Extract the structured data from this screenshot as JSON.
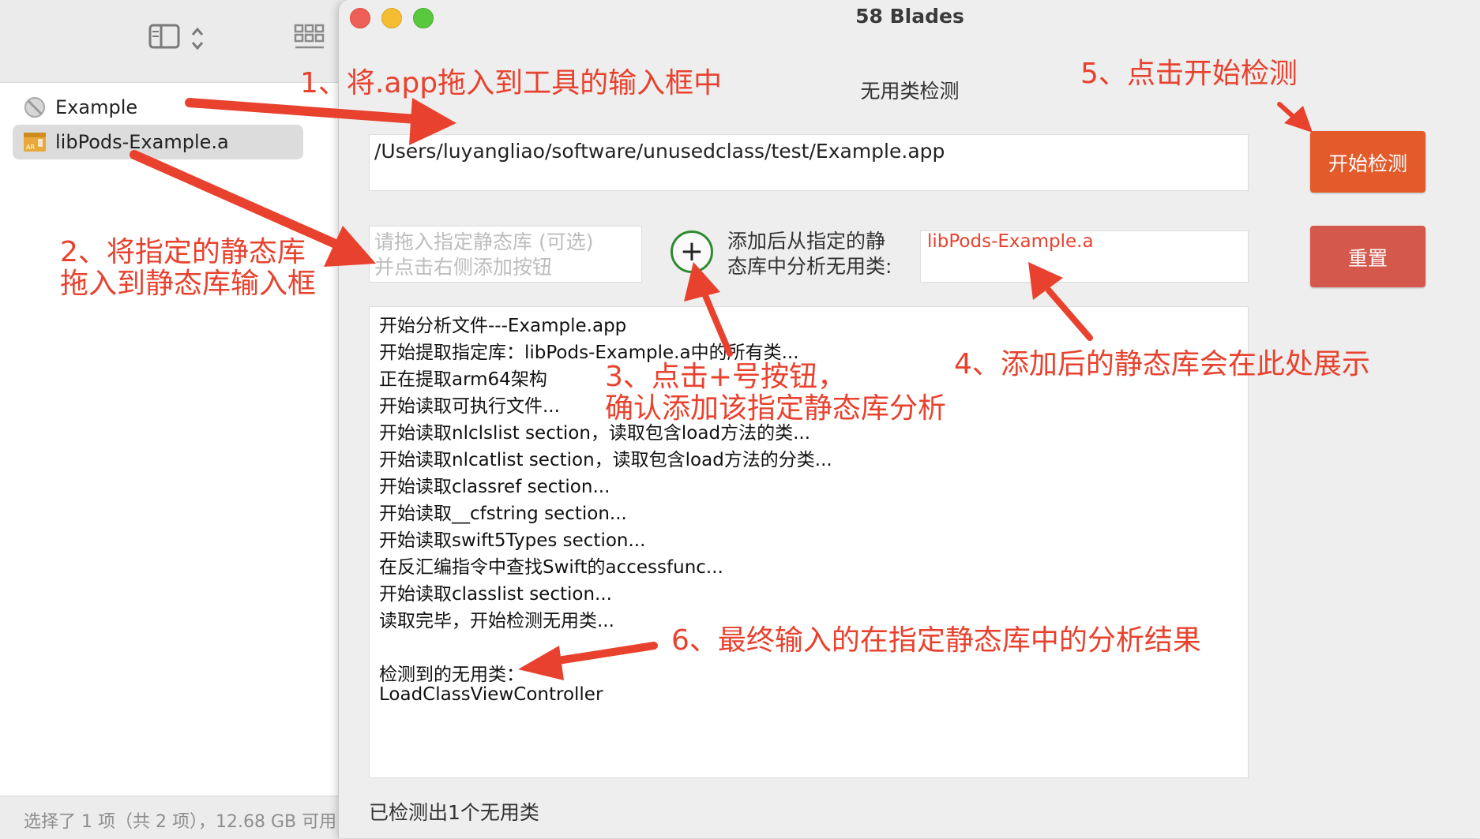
{
  "finder": {
    "sidebar_items": [
      {
        "label": "Example"
      },
      {
        "label": "libPods-Example.a"
      }
    ],
    "status": "选择了 1 项（共 2 项），12.68 GB 可用"
  },
  "window": {
    "title": "58 Blades",
    "heading": "无用类检测"
  },
  "inputs": {
    "app_path": "/Users/luyangliao/software/unusedclass/test/Example.app",
    "static_lib_placeholder": "请拖入指定静态库 (可选)\n并点击右侧添加按钮",
    "add_description": "添加后从指定的静\n态库中分析无用类:",
    "added_lib": "libPods-Example.a"
  },
  "buttons": {
    "start": "开始检测",
    "reset": "重置",
    "add": "+"
  },
  "log_lines": [
    "开始分析文件---Example.app",
    "开始提取指定库：libPods-Example.a中的所有类...",
    "正在提取arm64架构",
    "开始读取可执行文件...",
    "开始读取nlclslist section，读取包含load方法的类...",
    "开始读取nlcatlist section，读取包含load方法的分类...",
    "开始读取classref section...",
    "开始读取__cfstring section...",
    "开始读取swift5Types section...",
    "在反汇编指令中查找Swift的accessfunc...",
    "开始读取classlist section...",
    "读取完毕，开始检测无用类...",
    "",
    "检测到的无用类：",
    "LoadClassViewController"
  ],
  "status_text": "已检测出1个无用类",
  "annotations": {
    "step1": "1、将.app拖入到工具的输入框中",
    "step2": "2、将指定的静态库\n拖入到静态库输入框",
    "step3": "3、点击+号按钮，\n确认添加该指定静态库分析",
    "step4": "4、添加后的静态库会在此处展示",
    "step5": "5、点击开始检测",
    "step6": "6、最终输入的在指定静态库中的分析结果"
  },
  "colors": {
    "annotation": "#e8422e",
    "start_button": "#e35a2b",
    "reset_button": "#d4584c",
    "added_lib_text": "#e8422e",
    "add_button_ring": "#2f8a2f"
  },
  "icons": {
    "sidebar_toggle": "sidebar-icon",
    "grid_view": "grid-icon",
    "example_app": "app-icon",
    "static_lib": "archive-icon"
  }
}
